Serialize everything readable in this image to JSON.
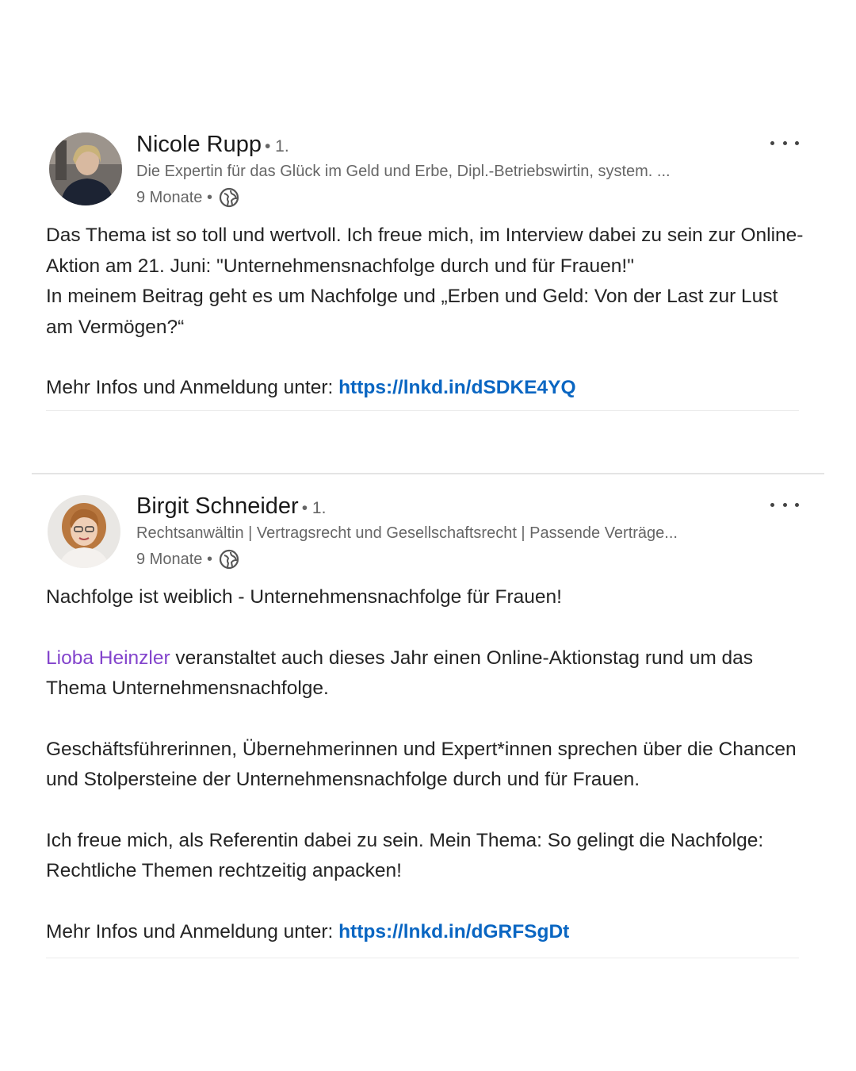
{
  "posts": [
    {
      "author": "Nicole Rupp",
      "degree": "• 1.",
      "headline": "Die Expertin für das Glück im Geld und Erbe, Dipl.-Betriebswirtin, system. ...",
      "time": "9 Monate •",
      "paragraphs": [
        "Das Thema ist so toll und wertvoll. Ich freue mich, im Interview dabei zu sein zur Online-Aktion am 21. Juni: \"Unternehmensnachfolge durch und für Frauen!\"",
        "In meinem Beitrag geht es um Nachfolge und „Erben und Geld: Von der Last zur Lust am Vermögen?“"
      ],
      "link_prefix": "Mehr Infos und Anmeldung unter: ",
      "link": "https://lnkd.in/dSDKE4YQ"
    },
    {
      "author": "Birgit Schneider",
      "degree": "• 1.",
      "headline": "Rechtsanwältin | Vertragsrecht und Gesellschaftsrecht | Passende Verträge...",
      "time": "9 Monate •",
      "intro": "Nachfolge ist weiblich - Unternehmensnachfolge für Frauen!",
      "mention": "Lioba Heinzler",
      "mention_rest": " veranstaltet auch dieses Jahr einen Online-Aktionstag rund um das Thema Unternehmensnachfolge.",
      "para3": "Geschäftsführerinnen, Übernehmerinnen und Expert*innen sprechen über die Chancen und Stolpersteine der Unternehmensnachfolge durch und für Frauen.",
      "para4": "Ich freue mich, als Referentin dabei zu sein. Mein Thema: So gelingt die Nachfolge: Rechtliche Themen rechtzeitig anpacken!",
      "link_prefix": "Mehr Infos und Anmeldung unter: ",
      "link": "https://lnkd.in/dGRFSgDt"
    }
  ],
  "icons": {
    "visibility": "globe-icon",
    "menu": "more-options-icon"
  },
  "colors": {
    "link": "#0a66c2",
    "mention": "#8344cc",
    "meta": "#666666"
  }
}
